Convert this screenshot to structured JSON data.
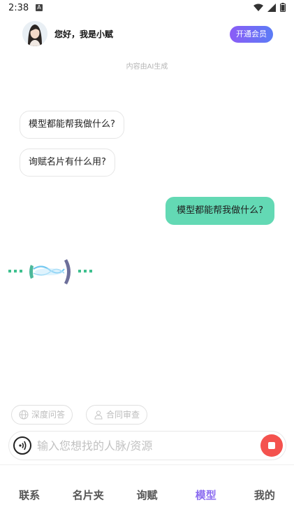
{
  "status_bar": {
    "time": "2:38",
    "notification_icon": "a-icon"
  },
  "header": {
    "greeting": "您好，我是小赋",
    "vip_button": "开通会员"
  },
  "ai_note": "内容由AI生成",
  "suggestions": [
    "模型都能帮我做什么?",
    "询赋名片有什么用?"
  ],
  "user_message": "模型都能帮我做什么?",
  "quick_chips": [
    {
      "label": "深度问答",
      "icon": "globe-icon"
    },
    {
      "label": "合同审查",
      "icon": "person-icon"
    }
  ],
  "input": {
    "placeholder": "输入您想找的人脉/资源",
    "value": ""
  },
  "tabs": [
    "联系",
    "名片夹",
    "询赋",
    "模型",
    "我的"
  ],
  "active_tab": "模型",
  "colors": {
    "accent": "#63d9b4",
    "vip_gradient": [
      "#8b5cf6",
      "#5b7cf6"
    ],
    "stop": "#f4524e",
    "active_tab": "#8b6cf0"
  }
}
